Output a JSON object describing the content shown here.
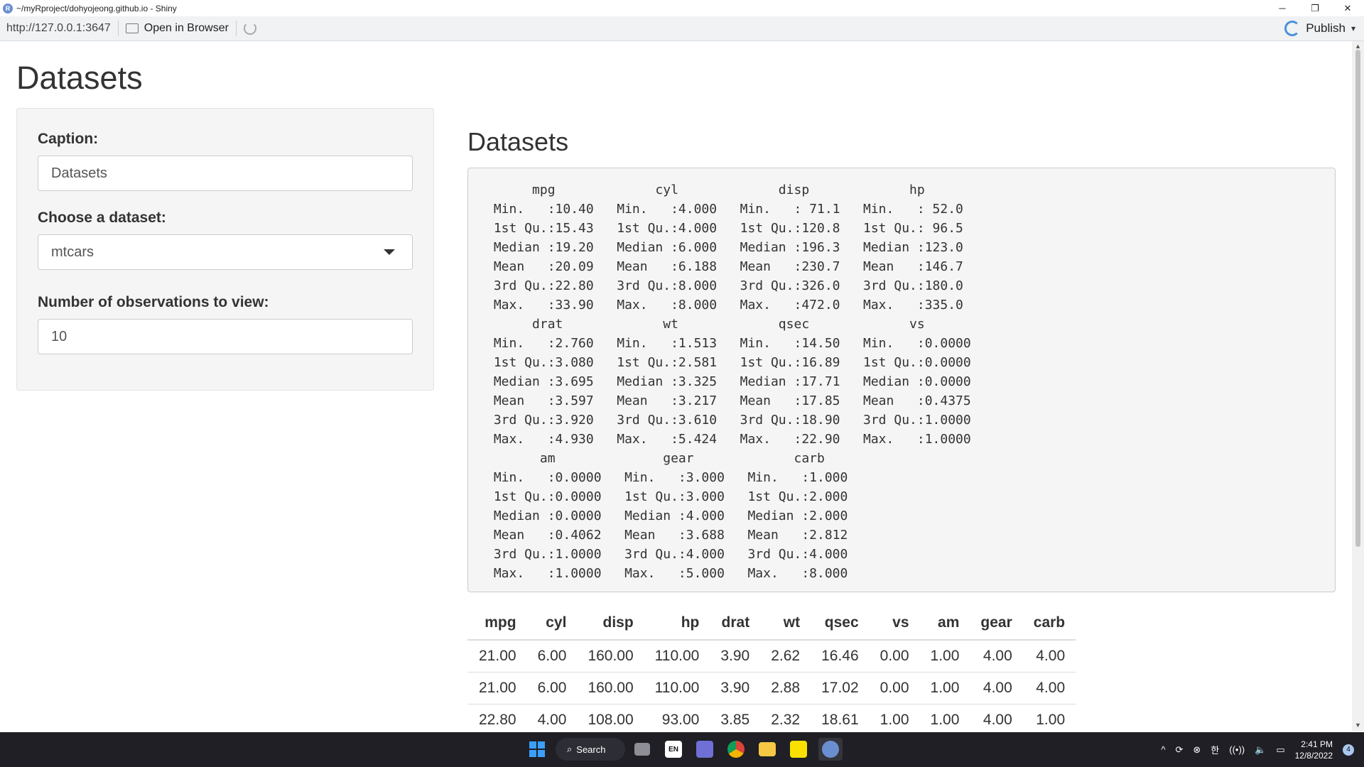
{
  "window": {
    "title": "~/myRproject/dohyojeong.github.io - Shiny",
    "app_icon_letter": "R",
    "minimize": "─",
    "restore": "❐",
    "close": "✕"
  },
  "toolbar": {
    "url": "http://127.0.0.1:3647",
    "open_in_browser": "Open in Browser",
    "publish": "Publish",
    "publish_caret": "▾"
  },
  "page": {
    "title": "Datasets"
  },
  "sidebar": {
    "caption_label": "Caption:",
    "caption_value": "Datasets",
    "dataset_label": "Choose a dataset:",
    "dataset_value": "mtcars",
    "obs_label": "Number of observations to view:",
    "obs_value": "10"
  },
  "main": {
    "title": "Datasets",
    "summary_text": "      mpg             cyl             disp             hp       \n Min.   :10.40   Min.   :4.000   Min.   : 71.1   Min.   : 52.0  \n 1st Qu.:15.43   1st Qu.:4.000   1st Qu.:120.8   1st Qu.: 96.5  \n Median :19.20   Median :6.000   Median :196.3   Median :123.0  \n Mean   :20.09   Mean   :6.188   Mean   :230.7   Mean   :146.7  \n 3rd Qu.:22.80   3rd Qu.:8.000   3rd Qu.:326.0   3rd Qu.:180.0  \n Max.   :33.90   Max.   :8.000   Max.   :472.0   Max.   :335.0  \n      drat             wt             qsec             vs        \n Min.   :2.760   Min.   :1.513   Min.   :14.50   Min.   :0.0000  \n 1st Qu.:3.080   1st Qu.:2.581   1st Qu.:16.89   1st Qu.:0.0000  \n Median :3.695   Median :3.325   Median :17.71   Median :0.0000  \n Mean   :3.597   Mean   :3.217   Mean   :17.85   Mean   :0.4375  \n 3rd Qu.:3.920   3rd Qu.:3.610   3rd Qu.:18.90   3rd Qu.:1.0000  \n Max.   :4.930   Max.   :5.424   Max.   :22.90   Max.   :1.0000  \n       am              gear             carb      \n Min.   :0.0000   Min.   :3.000   Min.   :1.000  \n 1st Qu.:0.0000   1st Qu.:3.000   1st Qu.:2.000  \n Median :0.0000   Median :4.000   Median :2.000  \n Mean   :0.4062   Mean   :3.688   Mean   :2.812  \n 3rd Qu.:1.0000   3rd Qu.:4.000   3rd Qu.:4.000  \n Max.   :1.0000   Max.   :5.000   Max.   :8.000  ",
    "table": {
      "columns": [
        "mpg",
        "cyl",
        "disp",
        "hp",
        "drat",
        "wt",
        "qsec",
        "vs",
        "am",
        "gear",
        "carb"
      ],
      "rows": [
        [
          "21.00",
          "6.00",
          "160.00",
          "110.00",
          "3.90",
          "2.62",
          "16.46",
          "0.00",
          "1.00",
          "4.00",
          "4.00"
        ],
        [
          "21.00",
          "6.00",
          "160.00",
          "110.00",
          "3.90",
          "2.88",
          "17.02",
          "0.00",
          "1.00",
          "4.00",
          "4.00"
        ],
        [
          "22.80",
          "4.00",
          "108.00",
          "93.00",
          "3.85",
          "2.32",
          "18.61",
          "1.00",
          "1.00",
          "4.00",
          "1.00"
        ]
      ]
    }
  },
  "taskbar": {
    "search_label": "Search",
    "lang": "EN",
    "ime": "한",
    "time": "2:41 PM",
    "date": "12/8/2022",
    "notification_count": "4",
    "tray_caret": "^"
  },
  "colors": {
    "accent": "#4a90d9",
    "taskbar_bg": "#1f1f25",
    "panel_bg": "#f5f5f5"
  }
}
